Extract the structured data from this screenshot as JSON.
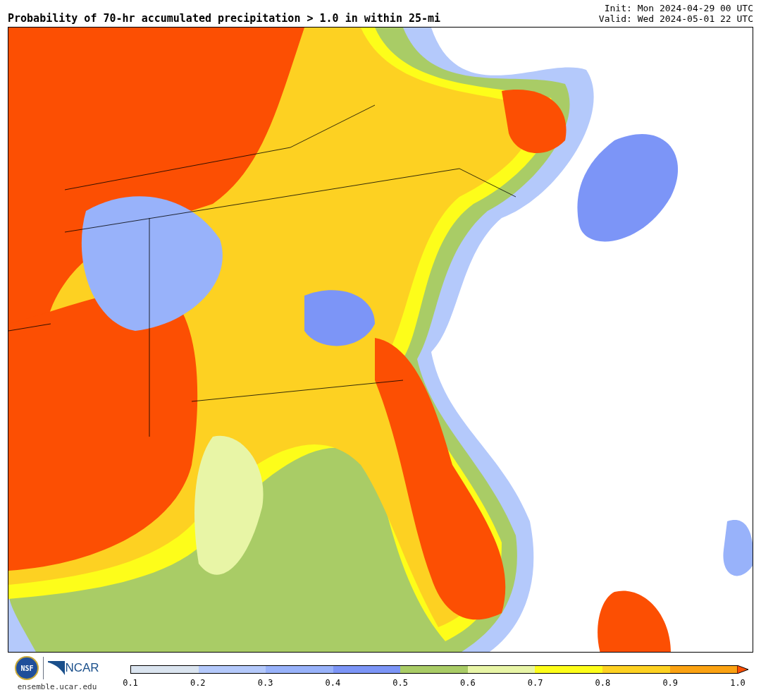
{
  "title": "Probability of 70-hr accumulated precipitation > 1.0 in within 25-mi",
  "init": "Init: Mon 2024-04-29 00 UTC",
  "valid": "Valid: Wed 2024-05-01 22 UTC",
  "logos": {
    "nsf": "NSF",
    "ncar": "NCAR",
    "url": "ensemble.ucar.edu"
  },
  "colorbar": {
    "segments": [
      {
        "color": "#dae4ef"
      },
      {
        "color": "#b4c9fb"
      },
      {
        "color": "#98b2fa"
      },
      {
        "color": "#7c95f7"
      },
      {
        "color": "#a9cc66"
      },
      {
        "color": "#e8f5a6"
      },
      {
        "color": "#fdfd1a"
      },
      {
        "color": "#fdd122"
      },
      {
        "color": "#fba212"
      }
    ],
    "extend": {
      "color": "#fc4f03"
    },
    "ticks": [
      "0.1",
      "0.2",
      "0.3",
      "0.4",
      "0.5",
      "0.6",
      "0.7",
      "0.8",
      "0.9",
      "1.0"
    ]
  }
}
